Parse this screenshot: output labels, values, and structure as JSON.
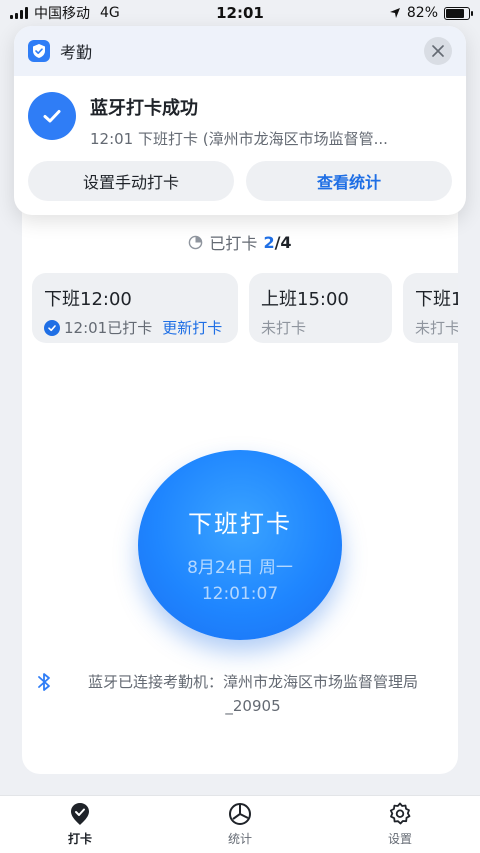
{
  "status_bar": {
    "carrier": "中国移动",
    "network": "4G",
    "time": "12:01",
    "battery_percent": "82%",
    "battery_level": 0.82
  },
  "notification": {
    "app_name": "考勤",
    "title": "蓝牙打卡成功",
    "subtitle": "12:01 下班打卡 (漳州市龙海区市场监督管...",
    "actions": {
      "manual": "设置手动打卡",
      "stats": "查看统计"
    }
  },
  "progress": {
    "label": "已打卡",
    "done": "2",
    "total": "/4"
  },
  "shifts": [
    {
      "title": "下班12:00",
      "status": "12:01已打卡",
      "link": "更新打卡"
    },
    {
      "title": "上班15:00",
      "status": "未打卡"
    },
    {
      "title": "下班1",
      "status": "未打卡"
    }
  ],
  "punch": {
    "label": "下班打卡",
    "date": "8月24日 周一",
    "time": "12:01:07"
  },
  "bluetooth": {
    "text": "蓝牙已连接考勤机：漳州市龙海区市场监督管理局_20905"
  },
  "tabs": [
    {
      "label": "打卡",
      "icon": "checkin-icon",
      "active": true
    },
    {
      "label": "统计",
      "icon": "stats-icon",
      "active": false
    },
    {
      "label": "设置",
      "icon": "settings-icon",
      "active": false
    }
  ],
  "colors": {
    "accent": "#1f6fe5",
    "button": "#1f86ff"
  }
}
